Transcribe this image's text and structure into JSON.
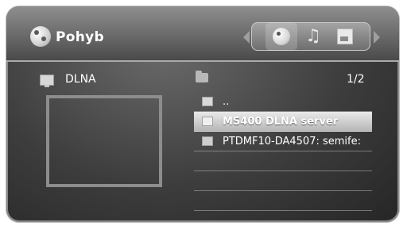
{
  "header": {
    "title": "Pohyb",
    "tabs": [
      {
        "label": "",
        "icon": "movie-reel-icon",
        "active": true
      },
      {
        "label": "",
        "icon": "music-note-icon",
        "active": false
      },
      {
        "label": "",
        "icon": "photo-icon",
        "active": false
      }
    ],
    "nav_icons": [
      "chevron-left-icon",
      "chevron-right-icon"
    ]
  },
  "left": {
    "source_label": "DLNA",
    "source_icon": "tv-icon"
  },
  "list": {
    "page_indicator": "1/2",
    "items": [
      {
        "label": "..",
        "icon": "folder-up-icon",
        "selected": false
      },
      {
        "label": "MS400 DLNA server",
        "icon": "server-icon",
        "selected": true
      },
      {
        "label": "PTDMF10-DA4507: semife:",
        "icon": "server-icon",
        "selected": false
      }
    ]
  }
}
